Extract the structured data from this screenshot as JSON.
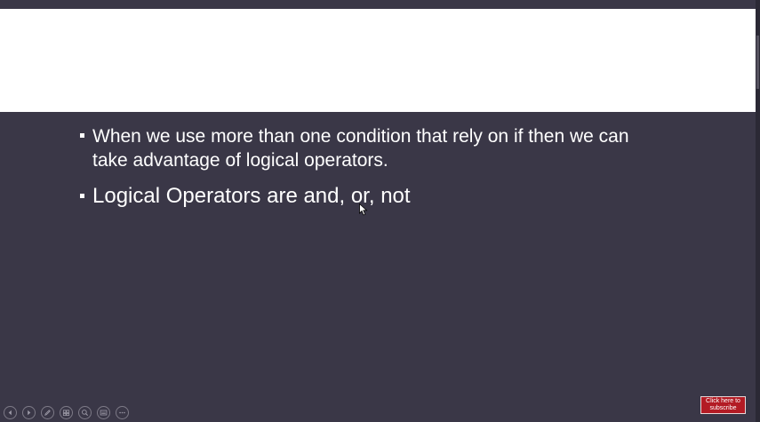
{
  "slide": {
    "bullets": [
      {
        "text": "When we use more than one condition that rely on if then we can take advantage of logical operators."
      },
      {
        "text": "Logical Operators are and, or, not"
      }
    ]
  },
  "controls": [
    {
      "icon": "previous-icon"
    },
    {
      "icon": "next-icon"
    },
    {
      "icon": "pen-icon"
    },
    {
      "icon": "slides-icon"
    },
    {
      "icon": "zoom-icon"
    },
    {
      "icon": "subtitles-icon"
    },
    {
      "icon": "more-options-icon"
    }
  ],
  "subscribe_badge": {
    "line1": "Click here to",
    "line2": "subscribe",
    "color": "#b31b24"
  },
  "colors": {
    "slide_background": "#3a3747",
    "title_band": "#ffffff",
    "text": "#ffffff"
  }
}
